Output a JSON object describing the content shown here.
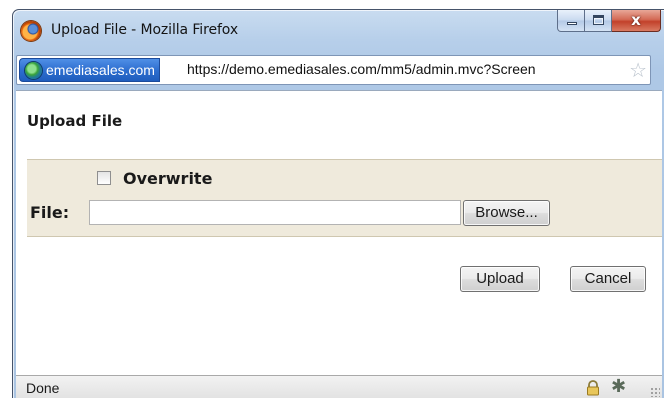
{
  "window": {
    "title": "Upload File - Mozilla Firefox",
    "controls": {
      "minimize": "minimize",
      "maximize": "maximize",
      "close": "x"
    }
  },
  "urlbar": {
    "site_identity": "emediasales.com",
    "url": "https://demo.emediasales.com/mm5/admin.mvc?Screen"
  },
  "page": {
    "title": "Upload File",
    "overwrite_label": "Overwrite",
    "overwrite_checked": false,
    "file_label": "File:",
    "file_value": "",
    "browse_label": "Browse...",
    "upload_label": "Upload",
    "cancel_label": "Cancel"
  },
  "status": {
    "text": "Done"
  },
  "colors": {
    "form_background": "#efeadc",
    "titlebar": "#b7cfea",
    "site_identity": "#2e6fd0",
    "close_button": "#c2412a"
  },
  "icons": [
    "firefox-icon",
    "globe-icon",
    "star-icon",
    "lock-icon",
    "bug-icon",
    "resize-grip-icon"
  ]
}
